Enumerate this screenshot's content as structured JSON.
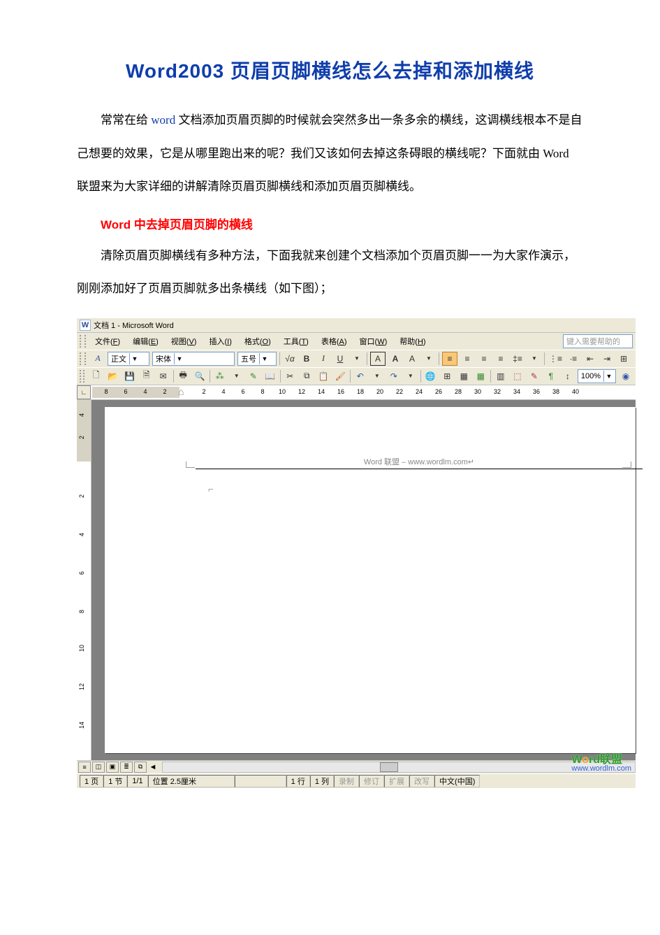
{
  "doc": {
    "title": "Word2003 页眉页脚横线怎么去掉和添加横线",
    "p1_prefix": "常常在给 ",
    "p1_word": "word",
    "p1_rest": " 文档添加页眉页脚的时候就会突然多出一条多余的横线，这调横线根本不是自己想要的效果，它是从哪里跑出来的呢？我们又该如何去掉这条碍眼的横线呢？下面就由 Word 联盟来为大家详细的讲解清除页眉页脚横线和添加页眉页脚横线。",
    "sub_red": "Word 中去掉页眉页脚的横线",
    "p2": "清除页眉页脚横线有多种方法，下面我就来创建个文档添加个页眉页脚一一为大家作演示，刚刚添加好了页眉页脚就多出条横线（如下图）；"
  },
  "app": {
    "title": "文档 1 - Microsoft Word",
    "menu": {
      "file": "文件(F)",
      "edit": "编辑(E)",
      "view": "视图(V)",
      "insert": "插入(I)",
      "format": "格式(O)",
      "tools": "工具(T)",
      "table": "表格(A)",
      "window": "窗口(W)",
      "help": "帮助(H)"
    },
    "help_placeholder": "键入需要帮助的",
    "format_toolbar": {
      "style_glyph": "A",
      "style": "正文",
      "font": "宋体",
      "size": "五号"
    },
    "zoom": "100%",
    "ruler_left": [
      "8",
      "6",
      "4",
      "2"
    ],
    "ruler_right": [
      "2",
      "4",
      "6",
      "8",
      "10",
      "12",
      "14",
      "16",
      "18",
      "20",
      "22",
      "24",
      "26",
      "28",
      "30",
      "32",
      "34",
      "36",
      "38",
      "40"
    ],
    "vruler_top": [
      "4",
      "2"
    ],
    "vruler_bottom": [
      "2",
      "4",
      "6",
      "8",
      "10",
      "12",
      "14"
    ],
    "header_text": "Word 联盟 – www.wordlm.com",
    "status": {
      "page": "1 页",
      "section": "1 节",
      "pages": "1/1",
      "position": "位置 2.5厘米",
      "line": "1 行",
      "col": "1 列",
      "rec": "录制",
      "rev": "修订",
      "ext": "扩展",
      "ovr": "改写",
      "lang": "中文(中国)"
    },
    "watermark": {
      "brand_w": "W",
      "brand_o": "o",
      "brand_rest": "rd联盟",
      "url": "www.wordlm.com"
    }
  }
}
